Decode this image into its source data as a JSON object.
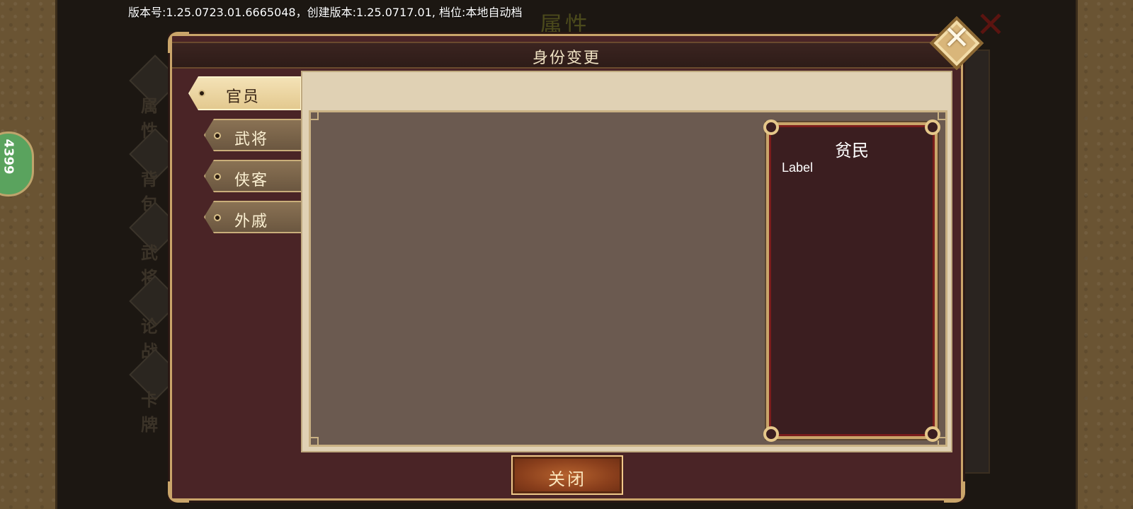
{
  "version_text": "版本号:1.25.0723.01.6665048，创建版本:1.25.0717.01, 档位:本地自动档",
  "background": {
    "title": "属性",
    "close_glyph": "✕",
    "side_menu": [
      "属性",
      "背包",
      "武将",
      "论战",
      "卡牌"
    ],
    "badge": "4399"
  },
  "dialog": {
    "title": "身份变更",
    "close_glyph": "✕",
    "tabs": [
      {
        "label": "官员",
        "active": true
      },
      {
        "label": "武将",
        "active": false
      },
      {
        "label": "侠客",
        "active": false
      },
      {
        "label": "外戚",
        "active": false
      }
    ],
    "identity_card": {
      "title": "贫民",
      "label": "Label"
    },
    "close_button_label": "关闭"
  }
}
